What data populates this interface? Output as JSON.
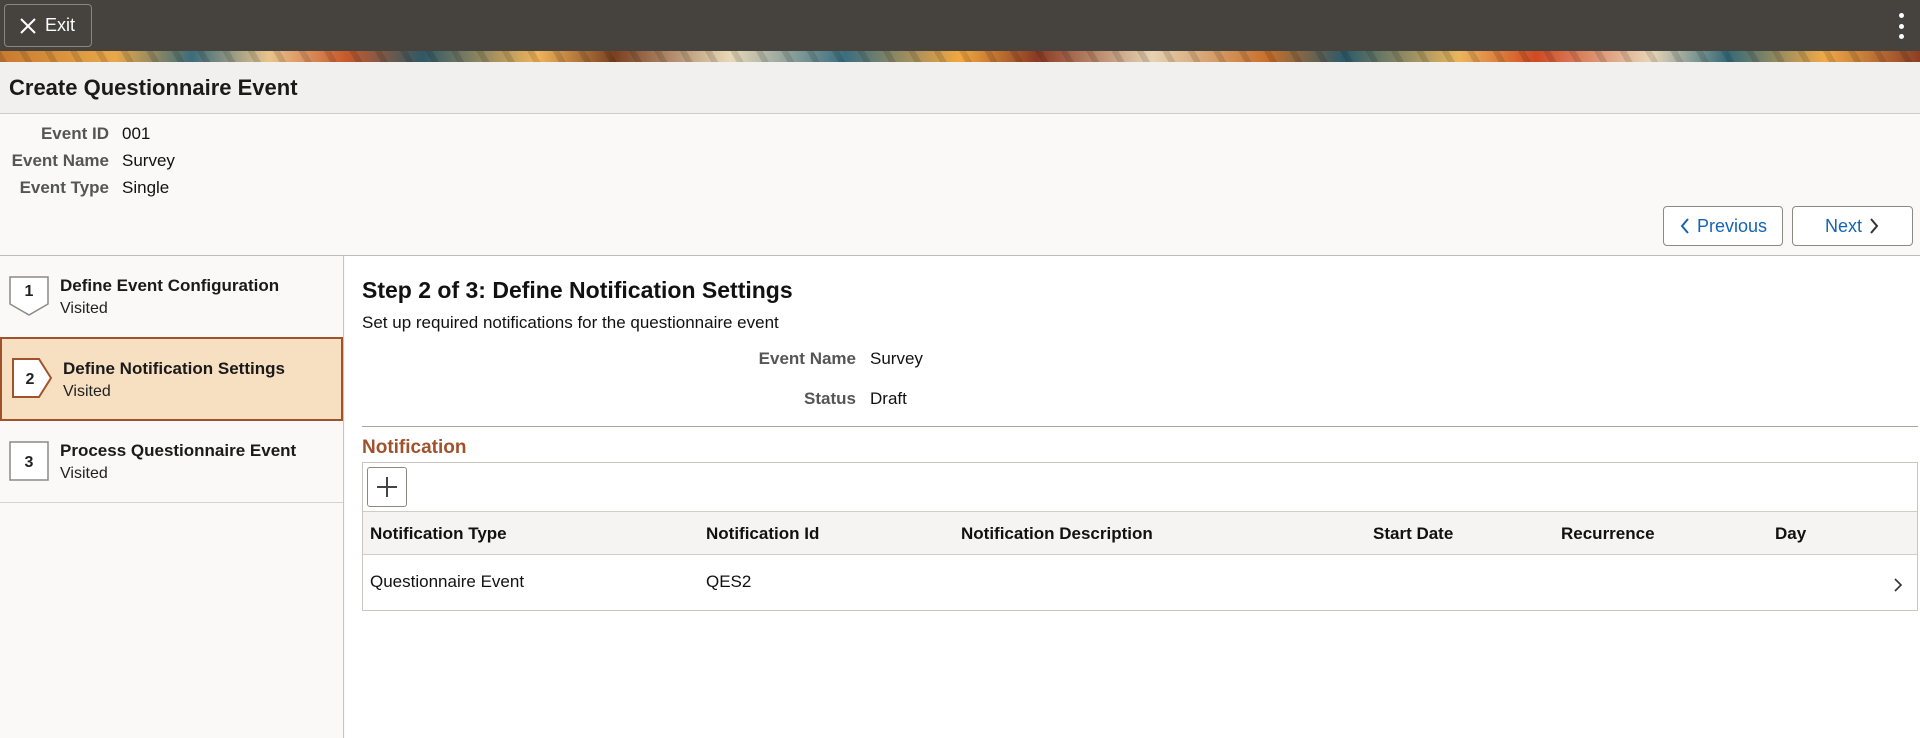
{
  "topbar": {
    "exit_label": "Exit"
  },
  "page": {
    "title": "Create Questionnaire Event"
  },
  "header": {
    "fields": [
      {
        "label": "Event ID",
        "value": "001"
      },
      {
        "label": "Event Name",
        "value": "Survey"
      },
      {
        "label": "Event Type",
        "value": "Single"
      }
    ],
    "previous_label": "Previous",
    "next_label": "Next"
  },
  "steps": [
    {
      "number": "1",
      "title": "Define Event Configuration",
      "status": "Visited"
    },
    {
      "number": "2",
      "title": "Define Notification Settings",
      "status": "Visited"
    },
    {
      "number": "3",
      "title": "Process Questionnaire Event",
      "status": "Visited"
    }
  ],
  "main": {
    "heading": "Step 2 of 3: Define Notification Settings",
    "subheading": "Set up required notifications for the questionnaire event",
    "fields": [
      {
        "label": "Event Name",
        "value": "Survey"
      },
      {
        "label": "Status",
        "value": "Draft"
      }
    ],
    "section_title": "Notification",
    "grid": {
      "columns": [
        "Notification Type",
        "Notification Id",
        "Notification Description",
        "Start Date",
        "Recurrence",
        "Day"
      ],
      "rows": [
        [
          "Questionnaire Event",
          "QES2",
          "",
          "",
          "",
          ""
        ]
      ]
    }
  },
  "colors": {
    "topbar": "#46423e",
    "accent": "#a0522d",
    "link": "#1464b4",
    "active_step_bg": "#f7e0c2"
  },
  "icons": {
    "exit": "close-icon",
    "menu": "kebab-menu-icon",
    "previous": "chevron-left-icon",
    "next": "chevron-right-icon",
    "add": "plus-icon",
    "row": "chevron-right-icon"
  }
}
